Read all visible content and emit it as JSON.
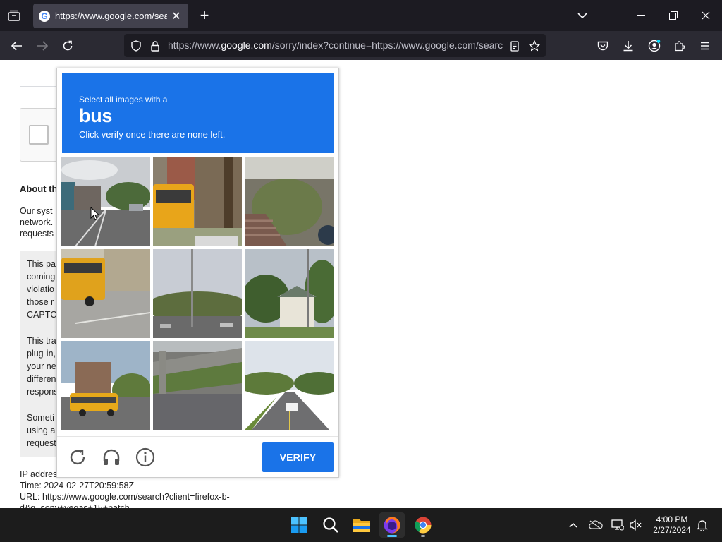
{
  "browser": {
    "tab": {
      "title": "https://www.google.com/search",
      "favicon": "google-g-icon"
    },
    "url": {
      "pre": "https://www.",
      "domain": "google.com",
      "post": "/sorry/index?continue=https://www.google.com/search"
    }
  },
  "page": {
    "about_heading": "About th",
    "about_lines": [
      "Our syst",
      "network.",
      "requests"
    ],
    "box_lines_1": [
      "This pa",
      "coming",
      "violatio",
      "those r",
      "CAPTC"
    ],
    "box_lines_2": [
      "This tra",
      "plug-in,",
      "your ne",
      "differen",
      "respons"
    ],
    "box_lines_3": [
      "Someti",
      "using a",
      "request"
    ],
    "ip_label": "IP addres",
    "time_line": "Time: 2024-02-27T20:59:58Z",
    "url_line_1": "URL: https://www.google.com/search?client=firefox-b-",
    "url_line_2": "d&q=sony+vegas+15+patch"
  },
  "captcha": {
    "instruction_line1": "Select all images with a",
    "target_word": "bus",
    "instruction_line3": "Click verify once there are none left.",
    "verify_label": "VERIFY",
    "accent_color": "#1a73e8",
    "tiles": [
      "street with buildings",
      "school bus",
      "stairs and railing",
      "school bus",
      "road with pole",
      "house and trees",
      "school bus",
      "overpass road",
      "highway with cars"
    ],
    "footer_icons": [
      "reload-icon",
      "headphones-icon",
      "info-icon"
    ]
  },
  "taskbar": {
    "apps": [
      "windows-start-icon",
      "search-icon",
      "file-explorer-icon",
      "firefox-icon",
      "chrome-icon"
    ],
    "time": "4:00 PM",
    "date": "2/27/2024"
  }
}
